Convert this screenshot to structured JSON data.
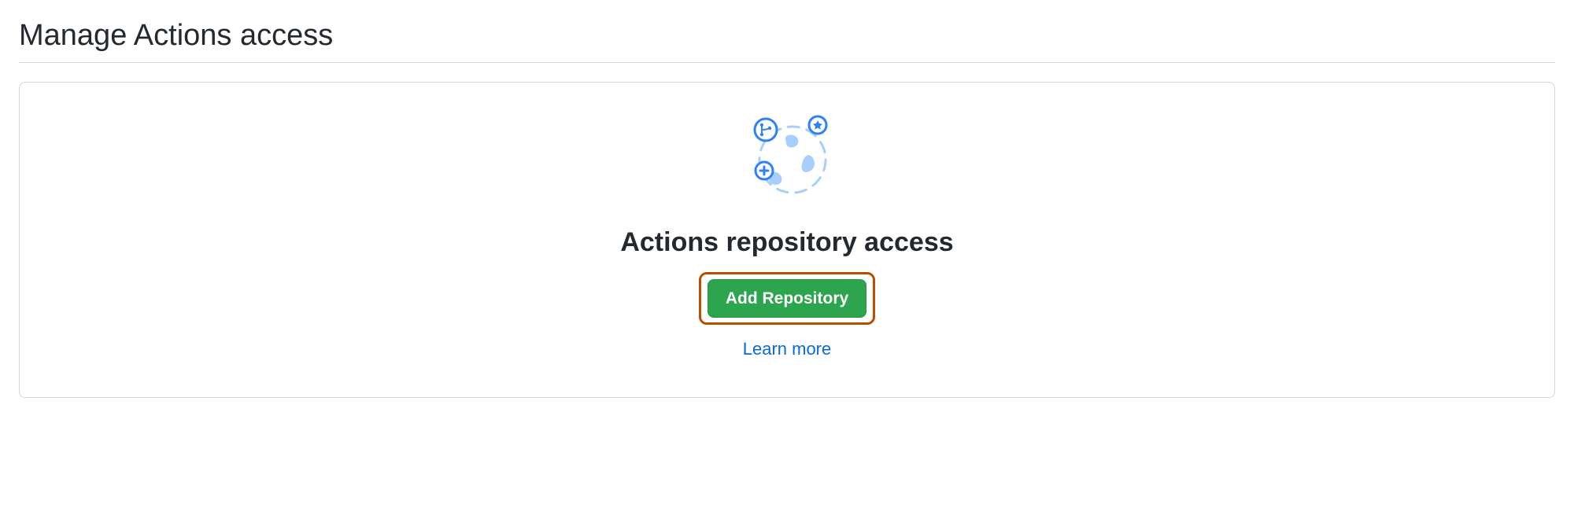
{
  "page": {
    "title": "Manage Actions access"
  },
  "card": {
    "heading": "Actions repository access",
    "add_button_label": "Add Repository",
    "learn_more_label": "Learn more"
  },
  "icons": {
    "illustration": "globe-network-icon"
  },
  "colors": {
    "primary_button": "#2da44e",
    "link": "#0969da",
    "highlight_border": "#bc4c00",
    "border": "#d0d7de"
  }
}
